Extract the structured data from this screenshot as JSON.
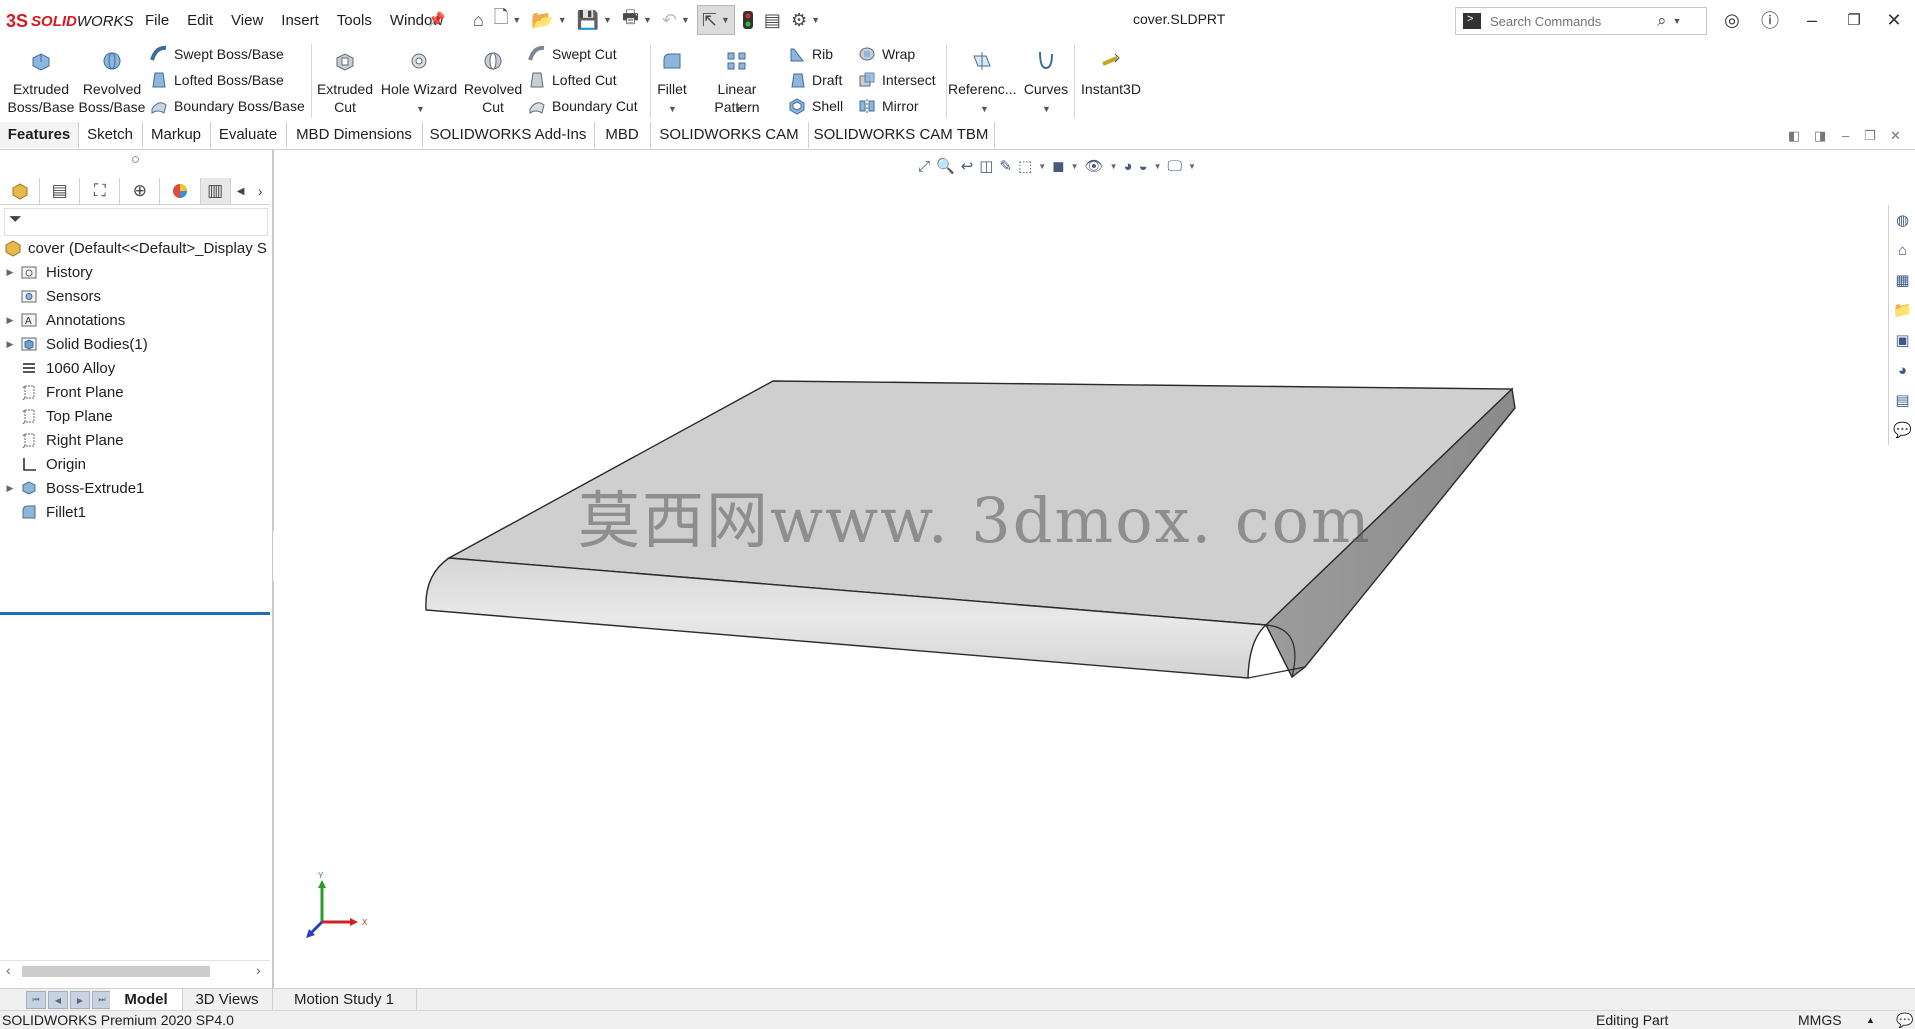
{
  "app": {
    "logo_prefix": "3S",
    "logo_bold": "SOLID",
    "logo_rest": "WORKS",
    "document_title": "cover.SLDPRT"
  },
  "menu": [
    "File",
    "Edit",
    "View",
    "Insert",
    "Tools",
    "Window"
  ],
  "search": {
    "placeholder": "Search Commands"
  },
  "command_manager": {
    "extruded_boss": [
      "Extruded",
      "Boss/Base"
    ],
    "revolved_boss": [
      "Revolved",
      "Boss/Base"
    ],
    "swept_boss": "Swept Boss/Base",
    "lofted_boss": "Lofted Boss/Base",
    "boundary_boss": "Boundary Boss/Base",
    "extruded_cut": [
      "Extruded",
      "Cut"
    ],
    "hole_wizard": "Hole Wizard",
    "revolved_cut": [
      "Revolved",
      "Cut"
    ],
    "swept_cut": "Swept Cut",
    "lofted_cut": "Lofted Cut",
    "boundary_cut": "Boundary Cut",
    "fillet": "Fillet",
    "linear_pattern": "Linear Pattern",
    "rib": "Rib",
    "draft": "Draft",
    "shell": "Shell",
    "wrap": "Wrap",
    "intersect": "Intersect",
    "mirror": "Mirror",
    "reference": "Referenc...",
    "curves": "Curves",
    "instant3d": "Instant3D"
  },
  "tabs": [
    "Features",
    "Sketch",
    "Markup",
    "Evaluate",
    "MBD Dimensions",
    "SOLIDWORKS Add-Ins",
    "MBD",
    "SOLIDWORKS CAM",
    "SOLIDWORKS CAM TBM"
  ],
  "feature_tree": {
    "root": "cover  (Default<<Default>_Display S",
    "items": [
      {
        "label": "History",
        "expandable": true,
        "icon": "history-folder-icon"
      },
      {
        "label": "Sensors",
        "expandable": false,
        "icon": "sensors-icon"
      },
      {
        "label": "Annotations",
        "expandable": true,
        "icon": "annotations-icon"
      },
      {
        "label": "Solid Bodies(1)",
        "expandable": true,
        "icon": "solid-bodies-icon"
      },
      {
        "label": "1060 Alloy",
        "expandable": false,
        "icon": "material-icon"
      },
      {
        "label": "Front Plane",
        "expandable": false,
        "icon": "plane-icon"
      },
      {
        "label": "Top Plane",
        "expandable": false,
        "icon": "plane-icon"
      },
      {
        "label": "Right Plane",
        "expandable": false,
        "icon": "plane-icon"
      },
      {
        "label": "Origin",
        "expandable": false,
        "icon": "origin-icon"
      },
      {
        "label": "Boss-Extrude1",
        "expandable": true,
        "icon": "extrude-feature-icon"
      },
      {
        "label": "Fillet1",
        "expandable": false,
        "icon": "fillet-feature-icon"
      }
    ]
  },
  "watermark": "莫西网www. 3dmox. com",
  "triad": {
    "x_label": "X",
    "y_label": "Y"
  },
  "bottom_tabs": [
    "Model",
    "3D Views",
    "Motion Study 1"
  ],
  "status": {
    "version": "SOLIDWORKS Premium 2020 SP4.0",
    "mode": "Editing Part",
    "units": "MMGS"
  },
  "colors": {
    "accent": "#1f6fb2",
    "brand_red": "#d71920",
    "part_face": "#cfcfcf"
  }
}
